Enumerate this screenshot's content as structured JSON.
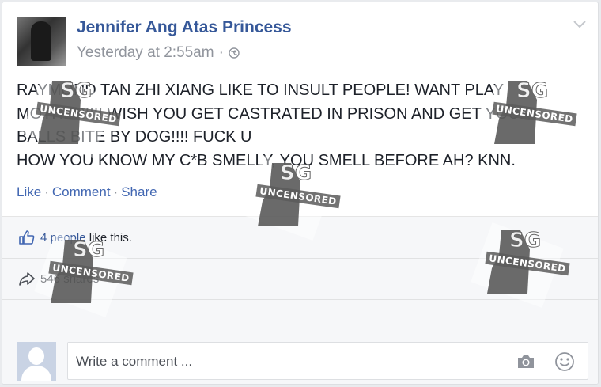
{
  "post": {
    "author": "Jennifer Ang Atas Princess",
    "timestamp": "Yesterday at 2:55am",
    "timestamp_sep": "·",
    "privacy_icon": "globe-icon",
    "menu_icon": "chevron-down-icon",
    "text_lines": [
      "RAYMOND TAN ZHI XIANG LIKE TO INSULT PEOPLE! WANT PLAY",
      "MOTHER!!!! WISH YOU GET CASTRATED IN PRISON AND GET YOUR",
      "BALLS BITE BY DOG!!!! FUCK U",
      "HOW YOU KNOW MY C*B SMELLY, YOU SMELL BEFORE AH? KNN."
    ],
    "actions": {
      "like": "Like",
      "comment": "Comment",
      "share": "Share",
      "sep": "·"
    }
  },
  "footer": {
    "likes": {
      "count_link": "4 people",
      "suffix": " like this.",
      "icon": "thumbs-up-icon"
    },
    "shares": {
      "count_link": "546 shares",
      "icon": "share-arrow-icon"
    },
    "comment": {
      "placeholder": "Write a comment ...",
      "camera_icon": "camera-icon",
      "emoji_icon": "smiley-icon"
    }
  },
  "watermark": {
    "sg": "SG",
    "uncensored": "UNCENSORED"
  },
  "colors": {
    "link": "#365899",
    "action_link": "#4267b2",
    "meta": "#90949c",
    "text": "#1d2129",
    "footer_bg": "#f6f7f9"
  }
}
